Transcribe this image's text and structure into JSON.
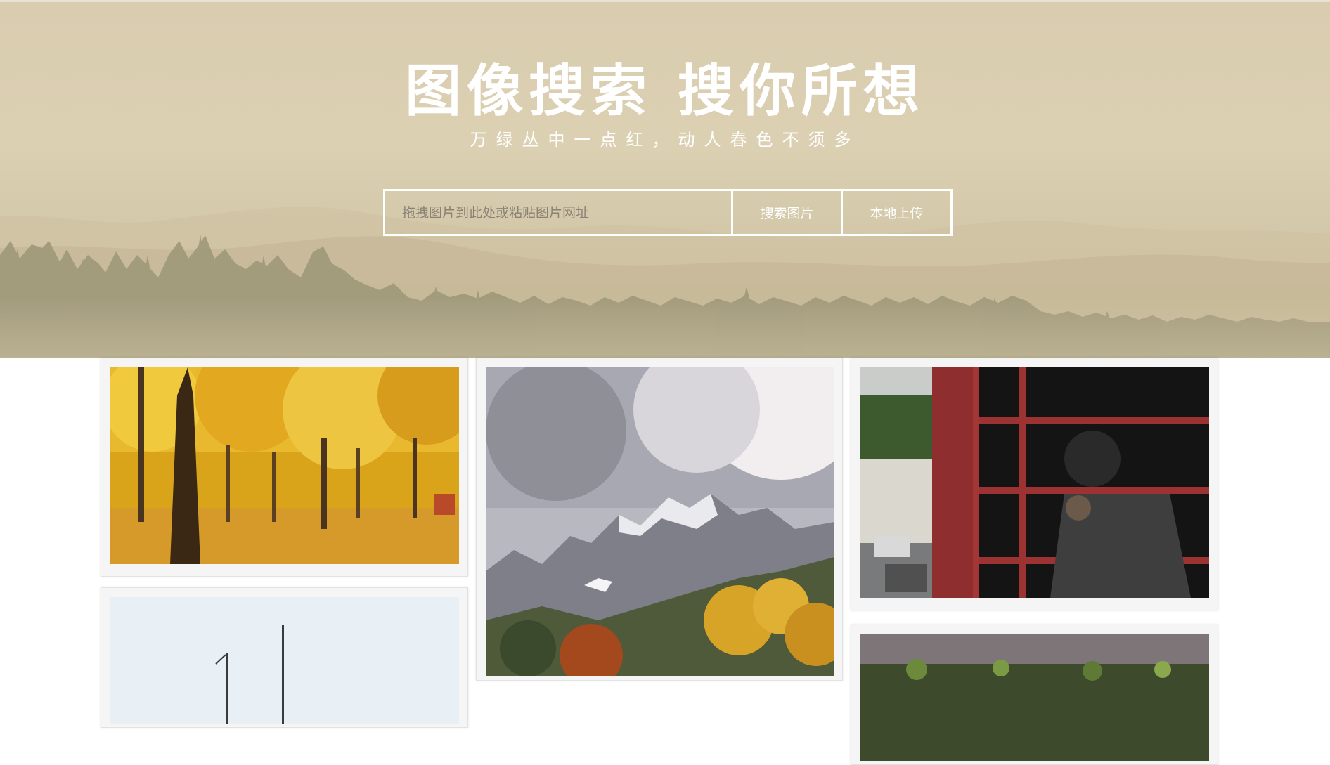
{
  "hero": {
    "title": "图像搜索 搜你所想",
    "subtitle": "万绿丛中一点红，动人春色不须多"
  },
  "search": {
    "placeholder": "拖拽图片到此处或粘贴图片网址",
    "value": "",
    "search_button": "搜索图片",
    "upload_button": "本地上传"
  },
  "gallery": {
    "images": [
      {
        "name": "autumn-forest-photo",
        "subject": "autumn forest"
      },
      {
        "name": "snowy-mountain-photo",
        "subject": "snowy mountain"
      },
      {
        "name": "phone-booth-photo",
        "subject": "phone booth"
      },
      {
        "name": "sailboat-photo",
        "subject": "sailboat"
      },
      {
        "name": "trees-photo",
        "subject": "trees"
      }
    ]
  },
  "colors": {
    "hero_bg": "#d9ccaf",
    "text": "#ffffff",
    "card_bg": "#f5f5f5"
  }
}
